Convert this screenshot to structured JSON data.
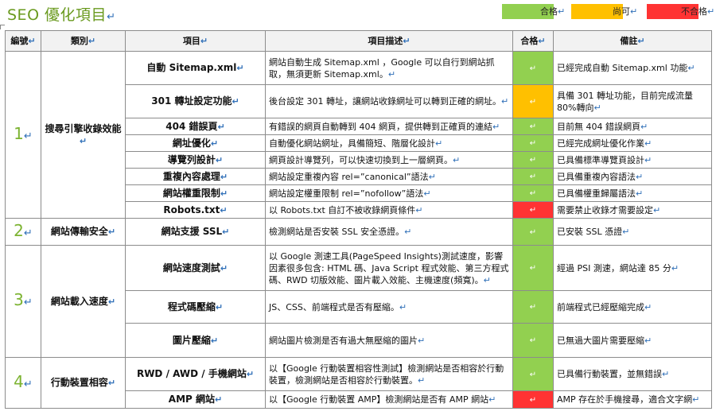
{
  "title": "SEO 優化項目",
  "mark": "↵",
  "legend": [
    {
      "label": "合格",
      "color": "#92d050"
    },
    {
      "label": "尚可",
      "color": "#ffc000"
    },
    {
      "label": "不合格",
      "color": "#ff3333"
    }
  ],
  "headers": [
    "編號",
    "類別",
    "項目",
    "項目描述",
    "合格",
    "備註"
  ],
  "groups": [
    {
      "number": "1",
      "category": "搜尋引擎收錄效能",
      "rows": [
        {
          "item": "自動 Sitemap.xml",
          "desc": "網站自動生成 Sitemap.xml ，Google 可以自行到網站抓取，無須更新 Sitemap.xml。",
          "status": "pass",
          "note": "已經完成自動 Sitemap.xml 功能"
        },
        {
          "item": "301 轉址設定功能",
          "desc": "後台設定 301 轉址，讓網站收錄網址可以轉到正確的網址。",
          "status": "fair",
          "note": "具備 301 轉址功能，目前完成流量 80%轉向"
        },
        {
          "item": "404 錯誤頁",
          "desc": "有錯誤的網頁自動轉到 404 網頁，提供轉到正確頁的連結",
          "status": "pass",
          "note": "目前無 404 錯誤網頁"
        },
        {
          "item": "網址優化",
          "desc": "自動優化網站網址，具備簡短、階層化設計",
          "status": "pass",
          "note": "已經完成網址優化作業"
        },
        {
          "item": "導覽列設計",
          "desc": "網頁設計導覽列，可以快速切換到上一層網頁。",
          "status": "pass",
          "note": "已具備標準導覽頁設計"
        },
        {
          "item": "重複內容處理",
          "desc": "網站設定重複內容 rel=”canonical”語法",
          "status": "pass",
          "note": "已具備重複內容語法"
        },
        {
          "item": "網站權重限制",
          "desc": "網站設定權重限制 rel=”nofollow”語法",
          "status": "pass",
          "note": "已具備權重歸屬語法"
        },
        {
          "item": "Robots.txt",
          "desc": "以 Robots.txt 自訂不被收錄網頁條件",
          "status": "fail",
          "note": "需要禁止收錄才需要設定"
        }
      ]
    },
    {
      "number": "2",
      "category": "網站傳輸安全",
      "rows": [
        {
          "item": "網站支援 SSL",
          "desc": "檢測網站是否安裝 SSL 安全憑證。",
          "status": "pass",
          "note": "已安裝 SSL 憑證"
        }
      ]
    },
    {
      "number": "3",
      "category": "網站載入速度",
      "rows": [
        {
          "item": "網站速度測試",
          "desc": "以 Google 測速工具(PageSpeed Insights)測試速度，影響因素很多包含: HTML 碼、Java Script 程式效能、第三方程式碼、RWD 切版效能、圖片載入效能、主機速度(頻寬)。",
          "status": "pass",
          "note": "經過 PSI 測速，網站達 85 分"
        },
        {
          "item": "程式碼壓縮",
          "desc": "JS、CSS、前端程式是否有壓縮。",
          "status": "pass",
          "note": "前端程式已經壓縮完成"
        },
        {
          "item": "圖片壓縮",
          "desc": "網站圖片檢測是否有過大無壓縮的圖片",
          "status": "pass",
          "note": "已無過大圖片需要壓縮"
        }
      ]
    },
    {
      "number": "4",
      "category": "行動裝置相容",
      "rows": [
        {
          "item": "RWD / AWD / 手機網站",
          "desc": "以【Google 行動裝置相容性測試】檢測網站是否相容於行動裝置，檢測網站是否相容於行動裝置。",
          "status": "pass",
          "note": "已具備行動裝置，並無錯誤"
        },
        {
          "item": "AMP 網站",
          "desc": "以【Google 行動裝置 AMP】檢測網站是否有 AMP 網站",
          "status": "fail",
          "note": "AMP 存在於手機搜尋，適合文字網"
        }
      ]
    }
  ],
  "status_colors": {
    "pass": "#92d050",
    "fair": "#ffc000",
    "fail": "#ff3333"
  }
}
